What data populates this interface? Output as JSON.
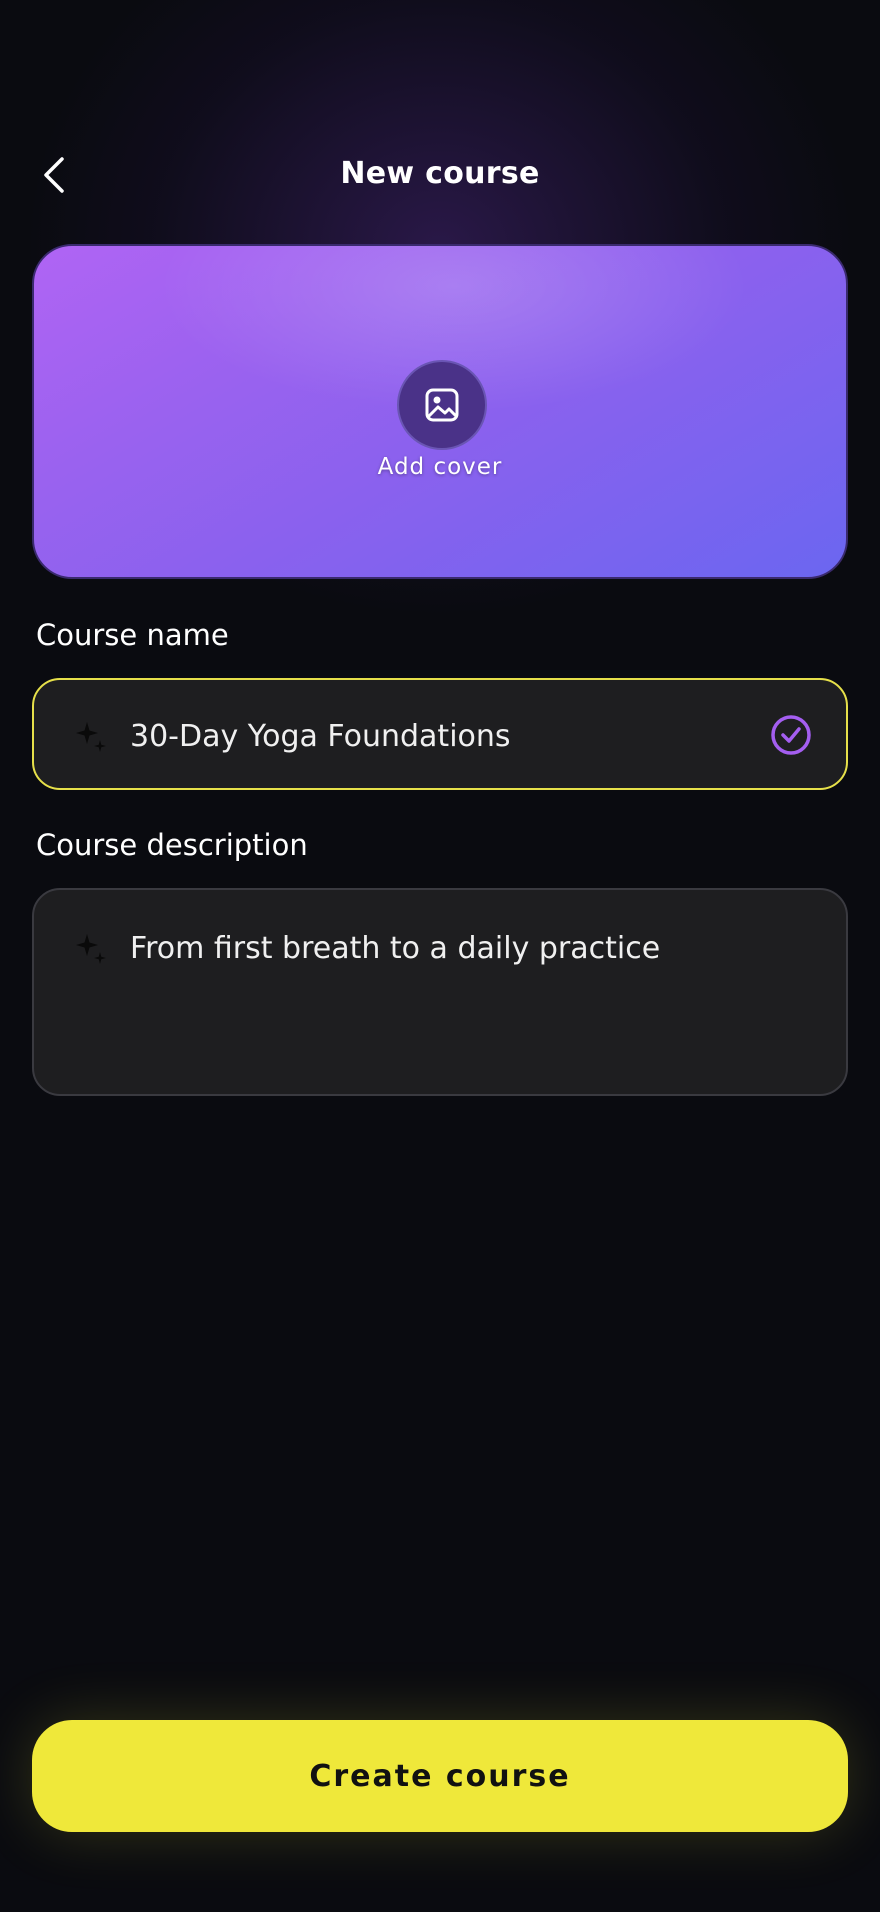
{
  "header": {
    "title": "New course",
    "back_icon": "chevron-left-icon"
  },
  "cover": {
    "label": "Add cover",
    "icon": "image-icon",
    "gradient_colors": [
      "#b064f4",
      "#6b66f0"
    ]
  },
  "form": {
    "name": {
      "label": "Course name",
      "value": "30-Day Yoga Foundations",
      "leading_icon": "sparkle-icon",
      "trailing_icon": "check-circle-icon",
      "border_color": "#e6e04a"
    },
    "description": {
      "label": "Course description",
      "value": "From first breath to a daily practice",
      "leading_icon": "sparkle-icon"
    }
  },
  "actions": {
    "create_label": "Create course",
    "create_color": "#efe83a"
  },
  "colors": {
    "background": "#0a0b10",
    "accent_purple": "#a45ef0",
    "accent_yellow": "#efe83a"
  }
}
